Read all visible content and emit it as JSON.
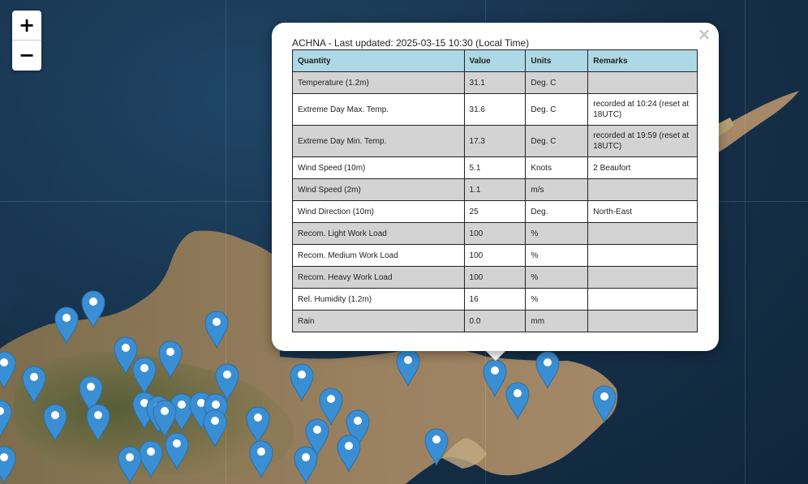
{
  "map": {
    "zoom_in_label": "+",
    "zoom_out_label": "−",
    "marker_color": "#3a8fd4",
    "marker_count": 47
  },
  "popup": {
    "close_label": "×",
    "title": "ACHNA - Last updated: 2025-03-15 10:30 (Local Time)",
    "header_color": "#add8e6",
    "columns": [
      "Quantity",
      "Value",
      "Units",
      "Remarks"
    ],
    "rows": [
      {
        "quantity": "Temperature (1.2m)",
        "value": "31.1",
        "units": "Deg. C",
        "remarks": ""
      },
      {
        "quantity": "Extreme Day Max. Temp.",
        "value": "31.6",
        "units": "Deg. C",
        "remarks": "recorded at 10:24 (reset at 18UTC)"
      },
      {
        "quantity": "Extreme Day Min. Temp.",
        "value": "17.3",
        "units": "Deg. C",
        "remarks": "recorded at 19:59 (reset at 18UTC)"
      },
      {
        "quantity": "Wind Speed (10m)",
        "value": "5.1",
        "units": "Knots",
        "remarks": "2 Beaufort"
      },
      {
        "quantity": "Wind Speed (2m)",
        "value": "1.1",
        "units": "m/s",
        "remarks": ""
      },
      {
        "quantity": "Wind Direction (10m)",
        "value": "25",
        "units": "Deg.",
        "remarks": "North-East"
      },
      {
        "quantity": "Recom. Light Work Load",
        "value": "100",
        "units": "%",
        "remarks": ""
      },
      {
        "quantity": "Recom. Medium Work Load",
        "value": "100",
        "units": "%",
        "remarks": ""
      },
      {
        "quantity": "Recom. Heavy Work Load",
        "value": "100",
        "units": "%",
        "remarks": ""
      },
      {
        "quantity": "Rel. Humidity (1.2m)",
        "value": "16",
        "units": "%",
        "remarks": ""
      },
      {
        "quantity": "Rain",
        "value": "0.0",
        "units": "mm",
        "remarks": ""
      }
    ]
  }
}
